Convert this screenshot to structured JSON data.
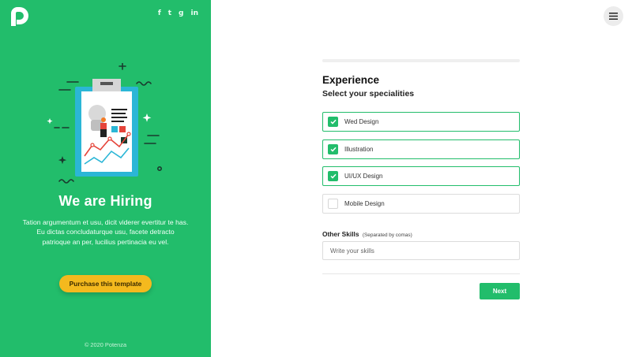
{
  "brand": {
    "logo_icon": "potenza-logo-icon",
    "accent_color": "#22bd6b",
    "button_color": "#f4b91e"
  },
  "social": [
    "f",
    "t",
    "g",
    "in"
  ],
  "hero": {
    "illustration_icon": "clipboard-chart-illustration",
    "title": "We are Hiring",
    "description": "Tation argumentum et usu, dicit viderer evertitur te has. Eu dictas concludaturque usu, facete detracto patrioque an per, lucilius pertinacia eu vel.",
    "purchase_label": "Purchase this template"
  },
  "footer": {
    "copyright": "© 2020 Potenza"
  },
  "menu": {
    "icon": "hamburger-menu-icon"
  },
  "form": {
    "title": "Experience",
    "subtitle": "Select your specialities",
    "options": [
      {
        "label": "Wed Design",
        "checked": true
      },
      {
        "label": "Illustration",
        "checked": true
      },
      {
        "label": "UI/UX Design",
        "checked": true
      },
      {
        "label": "Mobile Design",
        "checked": false
      }
    ],
    "other_skills_label": "Other Skills",
    "other_skills_hint": "(Separated by comas)",
    "skills_placeholder": "Write your skills",
    "skills_value": "",
    "next_label": "Next"
  }
}
